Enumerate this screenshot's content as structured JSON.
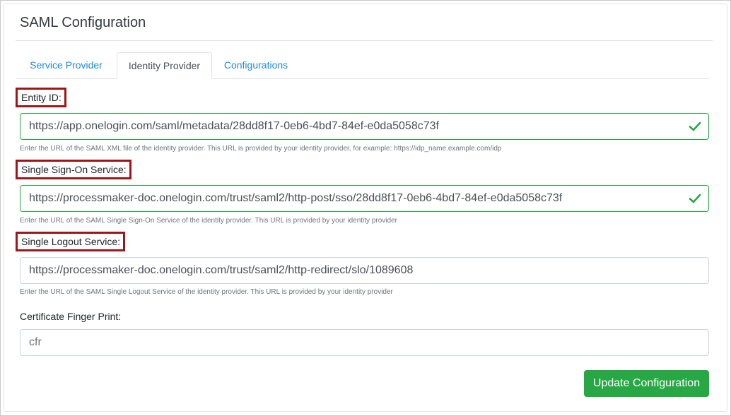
{
  "card": {
    "title": "SAML Configuration"
  },
  "tabs": [
    {
      "label": "Service Provider",
      "active": false
    },
    {
      "label": "Identity Provider",
      "active": true
    },
    {
      "label": "Configurations",
      "active": false
    }
  ],
  "form": {
    "entity_id": {
      "label": "Entity ID:",
      "value": "https://app.onelogin.com/saml/metadata/28dd8f17-0eb6-4bd7-84ef-e0da5058c73f",
      "help": "Enter the URL of the SAML XML file of the identity provider. This URL is provided by your identity provider, for example: https://idp_name.example.com/idp",
      "valid": true
    },
    "sso": {
      "label": "Single Sign-On Service:",
      "value": "https://processmaker-doc.onelogin.com/trust/saml2/http-post/sso/28dd8f17-0eb6-4bd7-84ef-e0da5058c73f",
      "help": "Enter the URL of the SAML Single Sign-On Service of the identity provider. This URL is provided by your identity provider",
      "valid": true
    },
    "slo": {
      "label": "Single Logout Service:",
      "value": "https://processmaker-doc.onelogin.com/trust/saml2/http-redirect/slo/1089608",
      "help": "Enter the URL of the SAML Single Logout Service of the identity provider. This URL is provided by your identity provider"
    },
    "cert": {
      "label": "Certificate Finger Print:",
      "placeholder": "cfr"
    }
  },
  "actions": {
    "update_label": "Update Configuration"
  },
  "colors": {
    "link": "#1e88e5",
    "success": "#28a745",
    "highlight": "#a11417"
  }
}
